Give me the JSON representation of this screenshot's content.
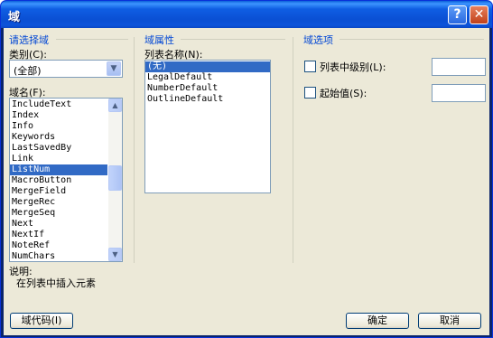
{
  "window": {
    "title": "域"
  },
  "titlebar": {
    "help_glyph": "?",
    "close_glyph": "✕"
  },
  "categories_group": {
    "title": "请选择域",
    "category_label": "类别(C):",
    "category_value": "(全部)",
    "fieldname_label": "域名(F):",
    "field_names": [
      "IncludeText",
      "Index",
      "Info",
      "Keywords",
      "LastSavedBy",
      "Link",
      "ListNum",
      "MacroButton",
      "MergeField",
      "MergeRec",
      "MergeSeq",
      "Next",
      "NextIf",
      "NoteRef",
      "NumChars"
    ],
    "selected_field": "ListNum",
    "description_label": "说明:",
    "description_text": "在列表中插入元素"
  },
  "properties_group": {
    "title": "域属性",
    "list_name_label": "列表名称(N):",
    "list_names": [
      "(无)",
      "LegalDefault",
      "NumberDefault",
      "OutlineDefault"
    ],
    "selected_list": "(无)"
  },
  "options_group": {
    "title": "域选项",
    "level_label": "列表中级别(L):",
    "level_value": "",
    "start_label": "起始值(S):",
    "start_value": ""
  },
  "buttons": {
    "field_codes": "域代码(I)",
    "ok": "确定",
    "cancel": "取消"
  },
  "icons": {
    "dropdown_arrow": "chevron-down-icon",
    "scroll_up": "arrow-up-icon",
    "scroll_down": "arrow-down-icon"
  }
}
